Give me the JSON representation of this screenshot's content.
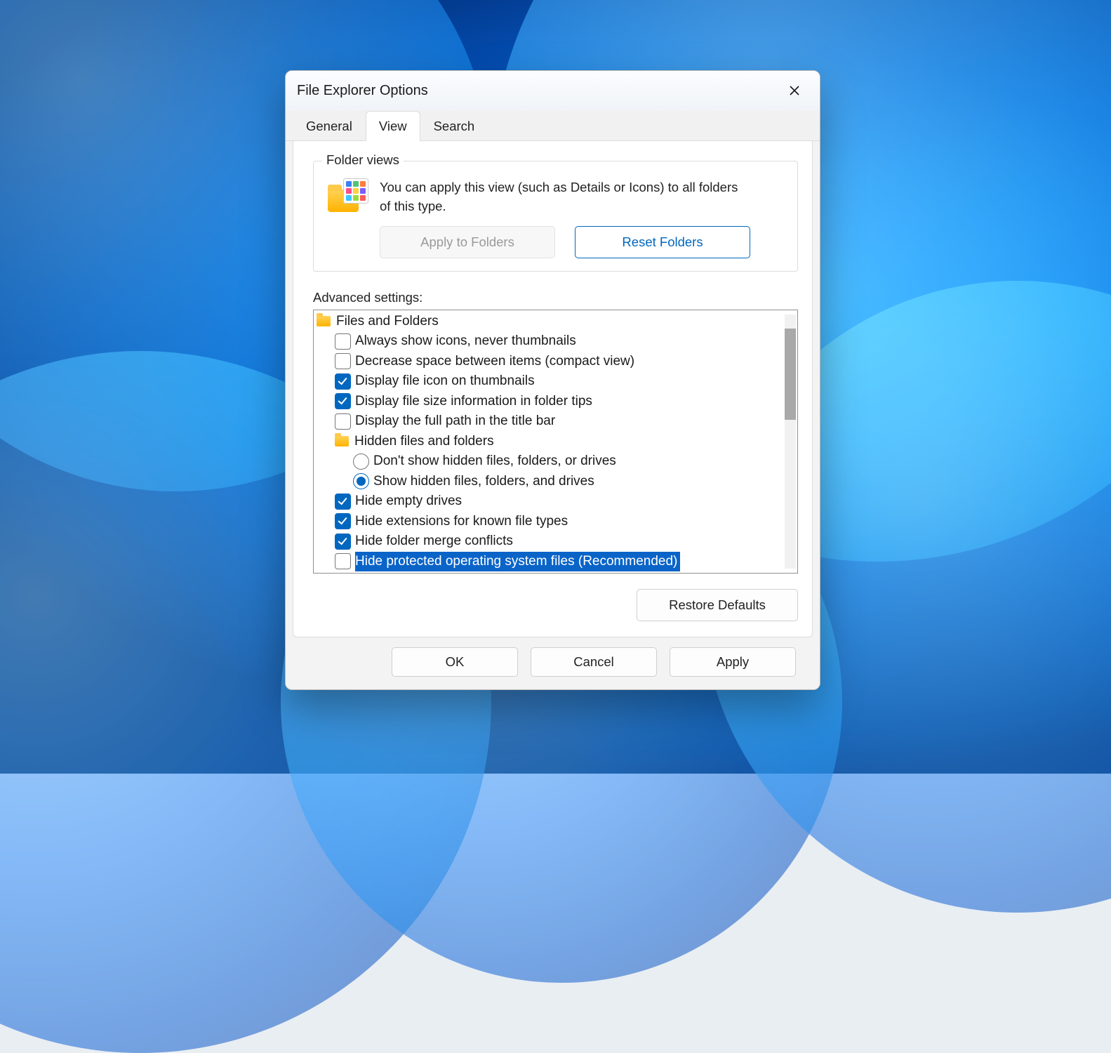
{
  "window": {
    "title": "File Explorer Options"
  },
  "tabs": {
    "general": "General",
    "view": "View",
    "search": "Search"
  },
  "folderviews": {
    "legend": "Folder views",
    "description": "You can apply this view (such as Details or Icons) to all folders of this type.",
    "apply": "Apply to Folders",
    "reset": "Reset Folders"
  },
  "advanced": {
    "label": "Advanced settings:",
    "group": "Files and Folders",
    "hiddenGroup": "Hidden files and folders",
    "items": {
      "alwaysIcons": "Always show icons, never thumbnails",
      "compact": "Decrease space between items (compact view)",
      "iconOnThumb": "Display file icon on thumbnails",
      "sizeInTips": "Display file size information in folder tips",
      "fullPath": "Display the full path in the title bar",
      "dontShowHidden": "Don't show hidden files, folders, or drives",
      "showHidden": "Show hidden files, folders, and drives",
      "hideEmpty": "Hide empty drives",
      "hideExt": "Hide extensions for known file types",
      "hideMerge": "Hide folder merge conflicts",
      "hideProtected": "Hide protected operating system files (Recommended)"
    }
  },
  "buttons": {
    "restore": "Restore Defaults",
    "ok": "OK",
    "cancel": "Cancel",
    "apply": "Apply"
  }
}
